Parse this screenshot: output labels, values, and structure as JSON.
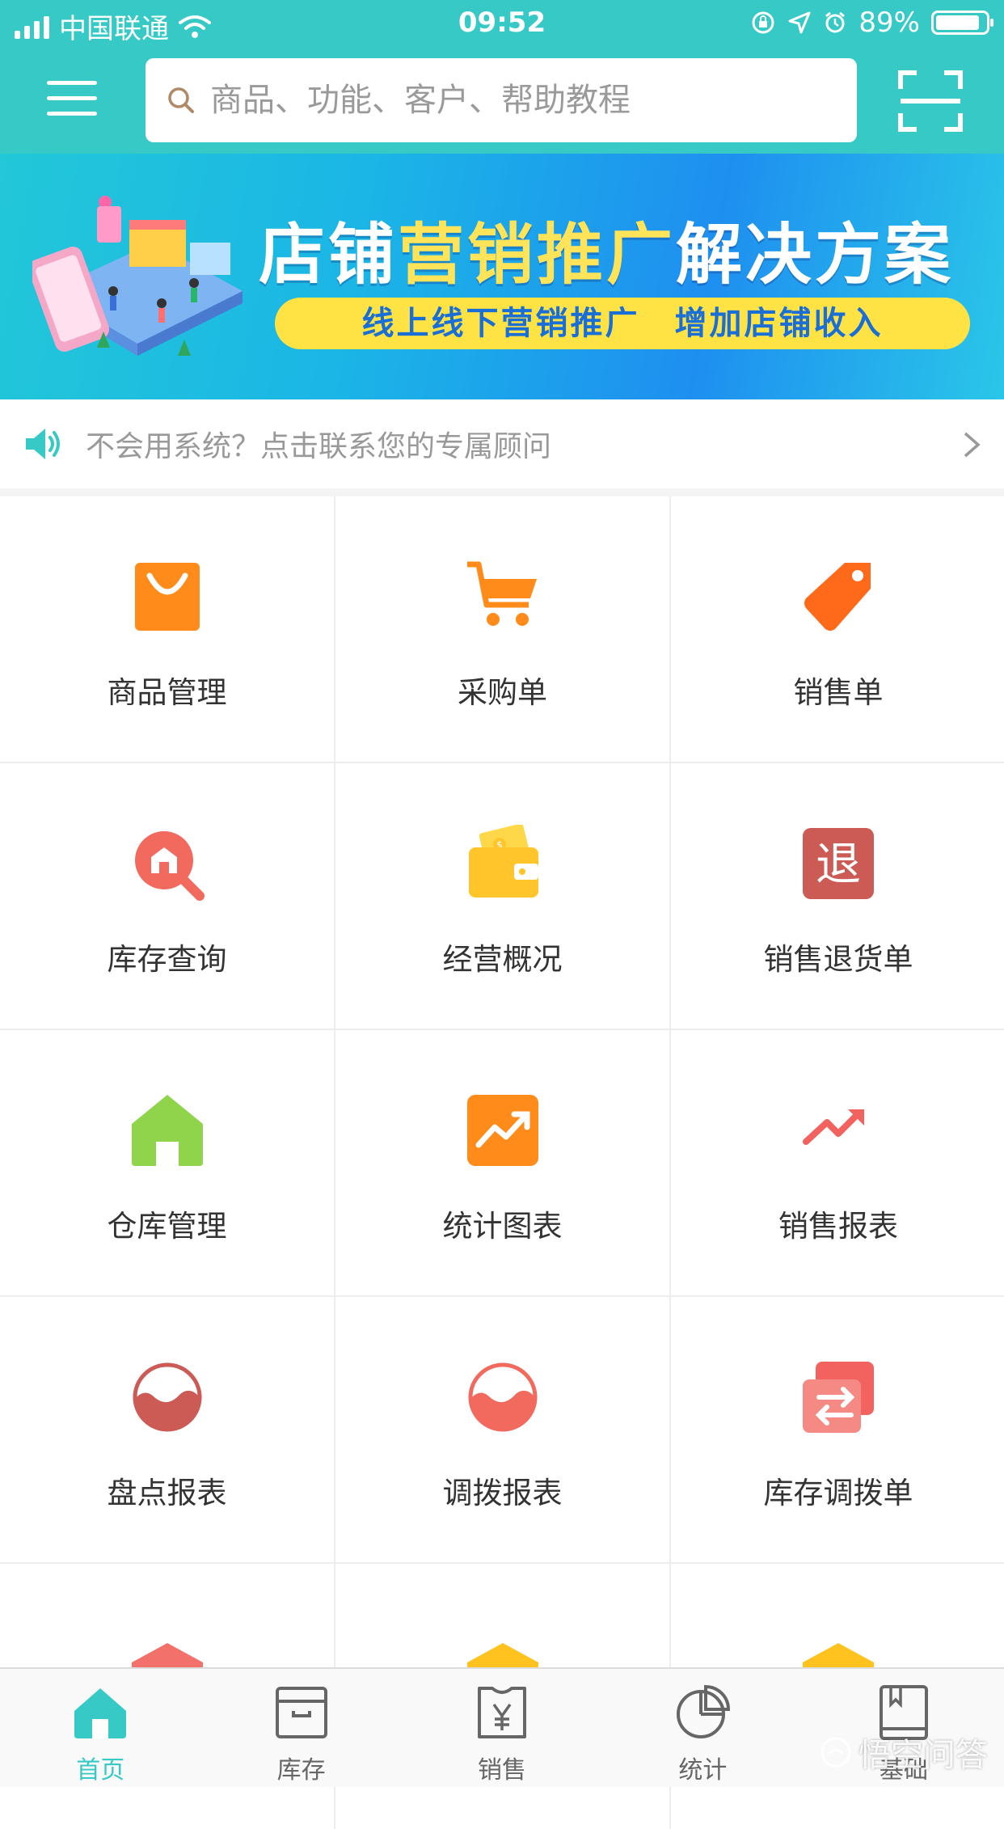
{
  "status_bar": {
    "carrier": "中国联通",
    "time": "09:52",
    "battery": "89%",
    "battery_level": 0.89
  },
  "header": {
    "search_placeholder": "商品、功能、客户、帮助教程"
  },
  "banner": {
    "title_part1": "店铺",
    "title_highlight": "营销推广",
    "title_part2": "解决方案",
    "subtitle": "线上线下营销推广　增加店铺收入"
  },
  "notice": {
    "text": "不会用系统？点击联系您的专属顾问"
  },
  "grid": {
    "items": [
      {
        "label": "商品管理",
        "icon": "shopping-bag-icon",
        "color": "#ff8c1a"
      },
      {
        "label": "采购单",
        "icon": "cart-icon",
        "color": "#ff8c1a"
      },
      {
        "label": "销售单",
        "icon": "price-tag-icon",
        "color": "#ff6a1a"
      },
      {
        "label": "库存查询",
        "icon": "inventory-search-icon",
        "color": "#f26a5e"
      },
      {
        "label": "经营概况",
        "icon": "wallet-icon",
        "color": "#ffc52a"
      },
      {
        "label": "销售退货单",
        "icon": "return-icon",
        "color": "#cc5a55",
        "glyph": "退"
      },
      {
        "label": "仓库管理",
        "icon": "warehouse-icon",
        "color": "#8fd44a"
      },
      {
        "label": "统计图表",
        "icon": "trend-chart-icon",
        "color": "#ff8c1a"
      },
      {
        "label": "销售报表",
        "icon": "sales-trend-icon",
        "color": "#f2625e"
      },
      {
        "label": "盘点报表",
        "icon": "stocktake-icon",
        "color": "#cc5a55"
      },
      {
        "label": "调拨报表",
        "icon": "transfer-report-icon",
        "color": "#f26a5e"
      },
      {
        "label": "库存调拨单",
        "icon": "transfer-icon",
        "color": "#f2625e"
      }
    ],
    "partial_icon_colors": [
      "#f2716a",
      "#ffc21f",
      "#ffc21f"
    ]
  },
  "tabbar": {
    "tabs": [
      {
        "label": "首页",
        "icon": "home-icon",
        "active": true
      },
      {
        "label": "库存",
        "icon": "inventory-box-icon",
        "active": false
      },
      {
        "label": "销售",
        "icon": "sales-yen-icon",
        "active": false
      },
      {
        "label": "统计",
        "icon": "pie-chart-icon",
        "active": false
      },
      {
        "label": "基础",
        "icon": "book-icon",
        "active": false
      }
    ]
  },
  "watermark": {
    "text": "悟空问答"
  },
  "colors": {
    "accent": "#36c9c6",
    "banner_highlight": "#ffe45a"
  }
}
